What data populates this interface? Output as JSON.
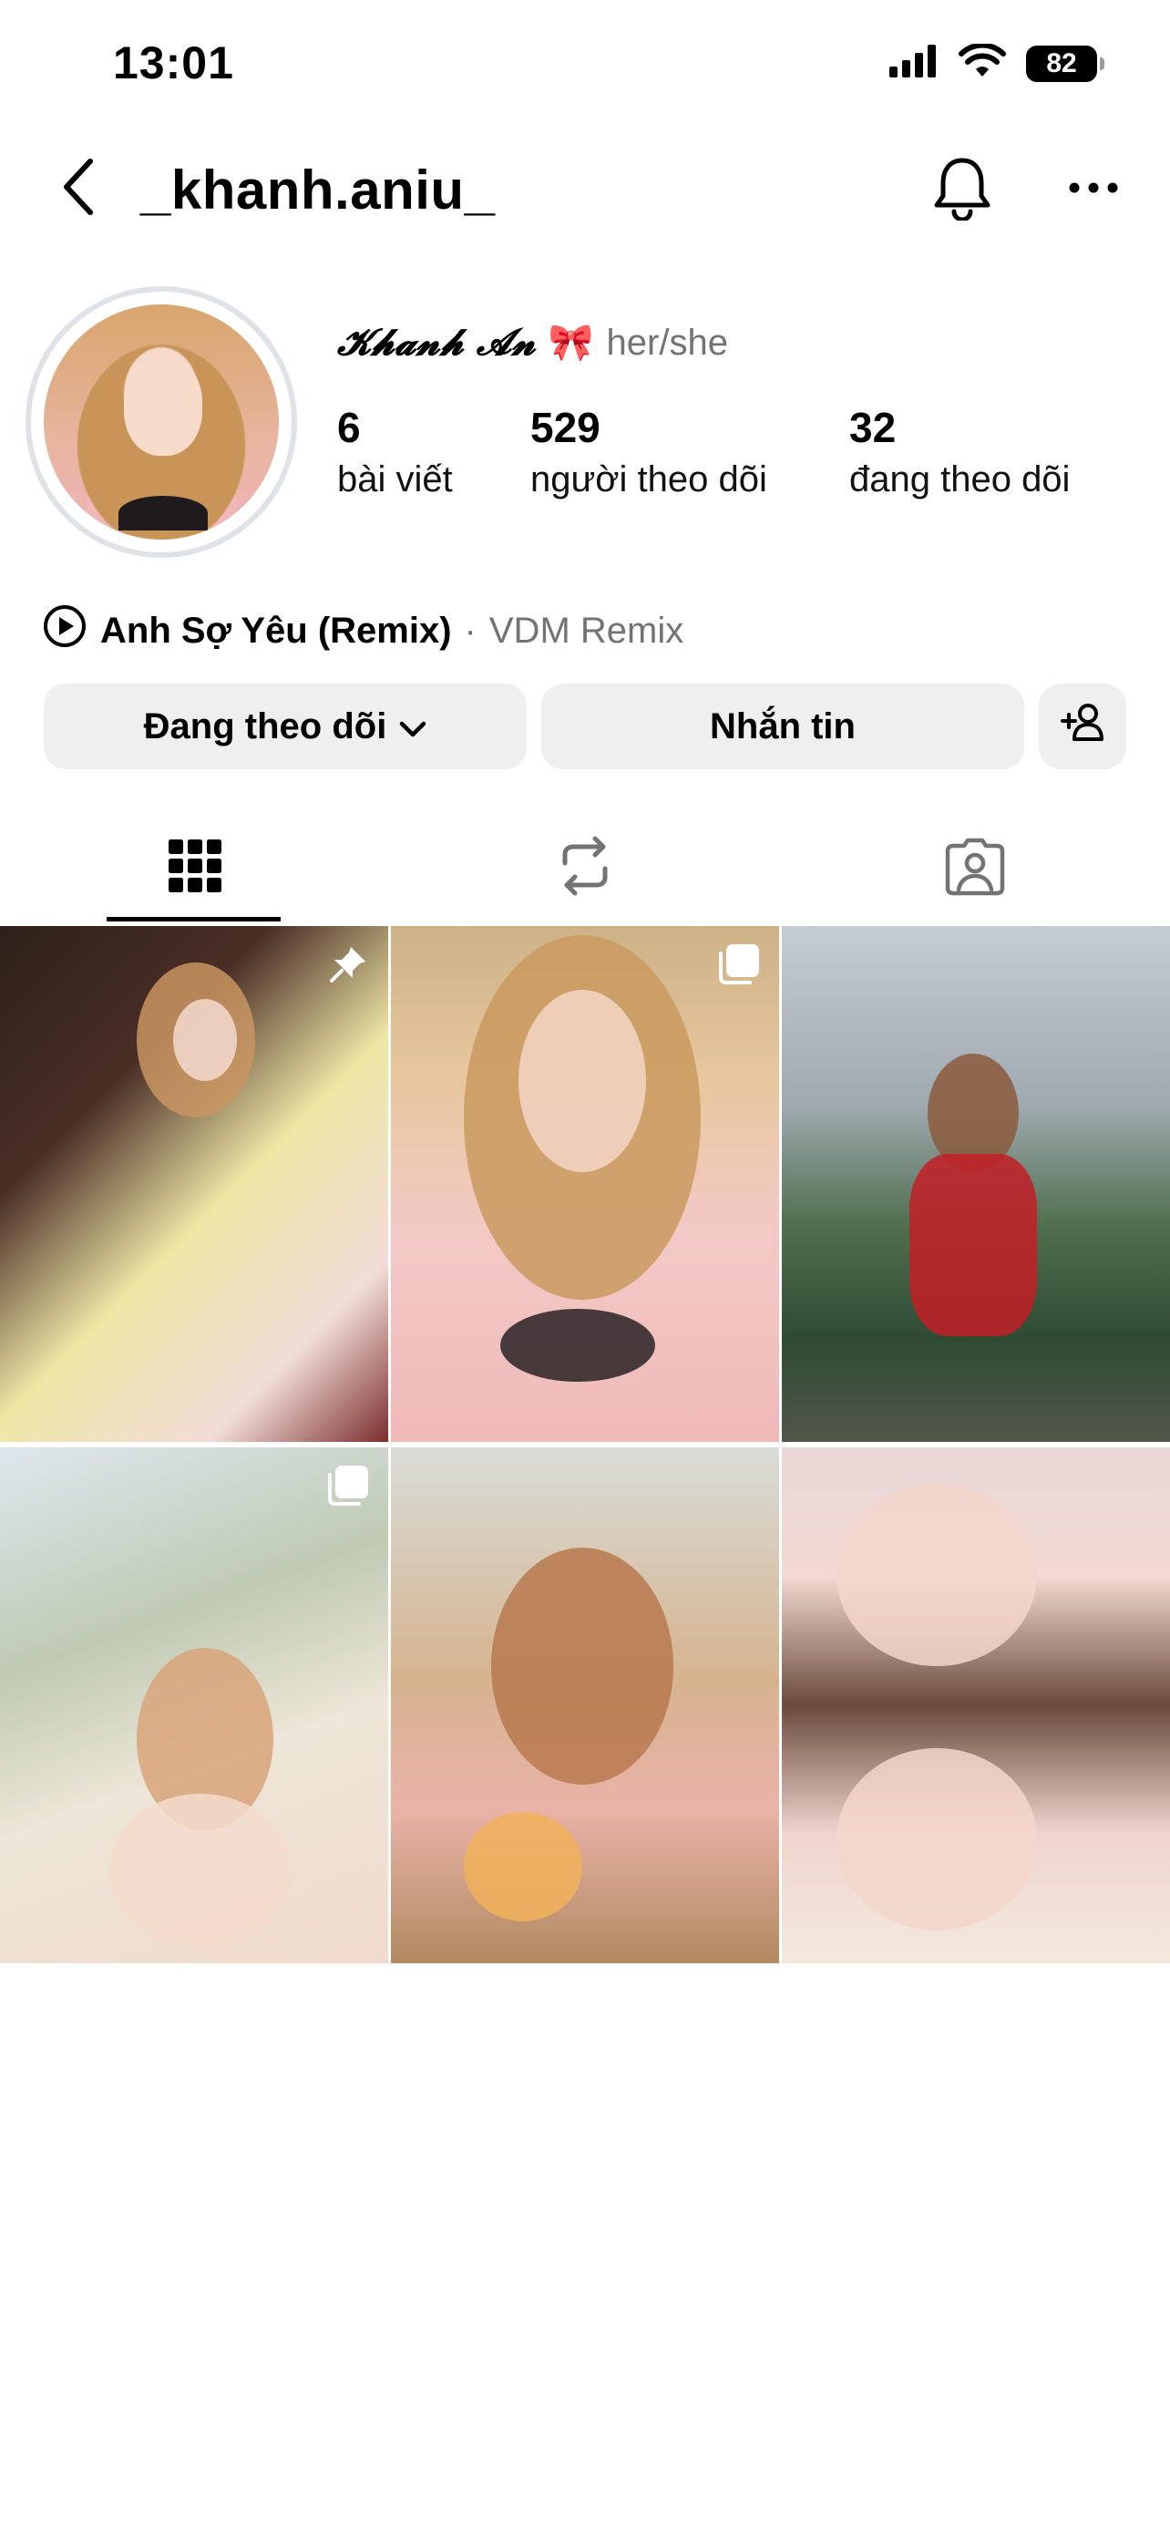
{
  "status_bar": {
    "time": "13:01",
    "battery": "82"
  },
  "header": {
    "username": "_khanh.aniu_"
  },
  "profile": {
    "display_name": "𝓚𝓱𝓪𝓷𝓱 𝓐𝓷",
    "name_emoji": "🎀",
    "pronouns": "her/she",
    "stats": [
      {
        "value": "6",
        "label": "bài viết"
      },
      {
        "value": "529",
        "label": "người theo dõi"
      },
      {
        "value": "32",
        "label": "đang theo dõi"
      }
    ],
    "music": {
      "song": "Anh Sợ Yêu (Remix)",
      "separator": "·",
      "artist": "VDM Remix"
    }
  },
  "actions": {
    "following_label": "Đang theo dõi",
    "message_label": "Nhắn tin"
  },
  "tabs": [
    {
      "name": "posts-grid",
      "icon": "grid-icon",
      "active": true
    },
    {
      "name": "reposts",
      "icon": "repost-icon",
      "active": false
    },
    {
      "name": "tagged",
      "icon": "tagged-person-icon",
      "active": false
    }
  ],
  "grid": [
    {
      "badge": "pin-icon"
    },
    {
      "badge": "carousel-icon"
    },
    {
      "badge": ""
    },
    {
      "badge": "carousel-icon"
    },
    {
      "badge": ""
    },
    {
      "badge": ""
    }
  ],
  "colors": {
    "button_bg": "#efefef",
    "secondary_text": "#737373",
    "text": "#000000",
    "background": "#ffffff"
  }
}
